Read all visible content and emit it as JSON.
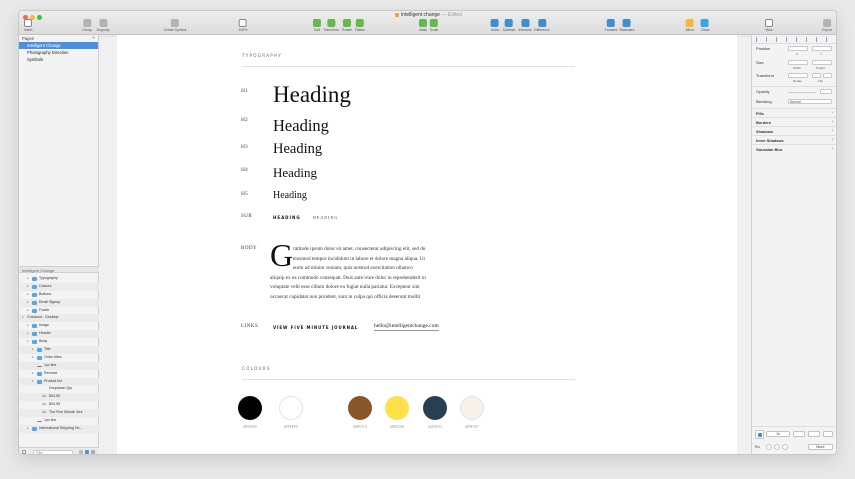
{
  "window": {
    "document_title": "intelligent change",
    "document_status": "— Edited"
  },
  "toolbar": {
    "items": [
      {
        "label": "Insert",
        "icon": "plus-icon"
      },
      {
        "label": "Group",
        "icon": "group-icon"
      },
      {
        "label": "Ungroup",
        "icon": "ungroup-icon"
      },
      {
        "label": "Create Symbol",
        "icon": "create-symbol-icon"
      },
      {
        "label": "100%",
        "icon": "zoom-icon"
      },
      {
        "label": "Edit",
        "icon": "edit-icon"
      },
      {
        "label": "Transform",
        "icon": "transform-icon"
      },
      {
        "label": "Rotate",
        "icon": "rotate-icon"
      },
      {
        "label": "Flatten",
        "icon": "flatten-icon"
      },
      {
        "label": "Mask",
        "icon": "mask-icon"
      },
      {
        "label": "Scale",
        "icon": "scale-icon"
      },
      {
        "label": "Union",
        "icon": "union-icon"
      },
      {
        "label": "Subtract",
        "icon": "subtract-icon"
      },
      {
        "label": "Intersect",
        "icon": "intersect-icon"
      },
      {
        "label": "Difference",
        "icon": "difference-icon"
      },
      {
        "label": "Forward",
        "icon": "forward-icon"
      },
      {
        "label": "Backward",
        "icon": "backward-icon"
      },
      {
        "label": "Mirror",
        "icon": "mirror-icon"
      },
      {
        "label": "Cloud",
        "icon": "cloud-icon"
      },
      {
        "label": "View",
        "icon": "view-icon"
      },
      {
        "label": "Export",
        "icon": "export-icon"
      }
    ]
  },
  "pages": {
    "header": "Pages",
    "items": [
      "Intelligent Change",
      "Photography Direction",
      "Symbols"
    ],
    "selected_index": 0
  },
  "layers_header": "Intelligent Change",
  "layers": [
    {
      "name": "Typography",
      "type": "folder",
      "depth": 1,
      "expanded": false
    },
    {
      "name": "Colours",
      "type": "folder",
      "depth": 1,
      "expanded": false
    },
    {
      "name": "Buttons",
      "type": "folder",
      "depth": 1,
      "expanded": false
    },
    {
      "name": "Email Signup",
      "type": "folder",
      "depth": 1,
      "expanded": false
    },
    {
      "name": "Footer",
      "type": "folder",
      "depth": 1,
      "expanded": false
    },
    {
      "name": "Checkout - Desktop",
      "type": "artboard",
      "depth": 0,
      "expanded": true
    },
    {
      "name": "Image",
      "type": "folder",
      "depth": 1,
      "expanded": false
    },
    {
      "name": "Header",
      "type": "folder",
      "depth": 1,
      "expanded": false
    },
    {
      "name": "Body",
      "type": "folder",
      "depth": 1,
      "expanded": true
    },
    {
      "name": "Title",
      "type": "folder",
      "depth": 2,
      "expanded": false
    },
    {
      "name": "Order titles",
      "type": "folder",
      "depth": 2,
      "expanded": false
    },
    {
      "name": "1px line",
      "type": "line",
      "depth": 2,
      "expanded": false
    },
    {
      "name": "Remove",
      "type": "folder",
      "depth": 2,
      "expanded": false
    },
    {
      "name": "Product list",
      "type": "folder",
      "depth": 2,
      "expanded": true
    },
    {
      "name": "Dropdown Qty",
      "type": "symbol",
      "depth": 3,
      "expanded": false
    },
    {
      "name": "$34.95",
      "type": "text",
      "depth": 3,
      "expanded": false
    },
    {
      "name": "$34.95",
      "type": "text",
      "depth": 3,
      "expanded": false
    },
    {
      "name": "The Five Minute Jour",
      "type": "text",
      "depth": 3,
      "expanded": false
    },
    {
      "name": "1px line",
      "type": "line",
      "depth": 2,
      "expanded": false
    },
    {
      "name": "International Shipping Ter...",
      "type": "folder",
      "depth": 1,
      "expanded": false
    }
  ],
  "filter": {
    "placeholder": "Filter"
  },
  "artboard": {
    "typography_section": "TYPOGRAPHY",
    "headings": [
      {
        "label": "H1",
        "text": "Heading"
      },
      {
        "label": "H2",
        "text": "Heading"
      },
      {
        "label": "H3",
        "text": "Heading"
      },
      {
        "label": "H4",
        "text": "Heading"
      },
      {
        "label": "H5",
        "text": "Heading"
      }
    ],
    "sub": {
      "label": "SUB",
      "heavy": "HEADING",
      "light": "HEADING"
    },
    "body": {
      "label": "BODY",
      "dropcap": "G",
      "lines": [
        "ratitude ipsum dolor sit amet, consectetur adipiscing elit, sed do",
        "eiusmod tempor incididunt ut labore et dolore magna aliqua. Ut",
        "enim ad minim veniam, quis nostrud exercitation ullamco",
        "aliquip ex ea commodo consequat. Duis aute irure dolor in reprehenderit in",
        "voluptate velit esse cillum dolore eu fugiat nulla pariatur. Excepteur sint",
        "occaecat cupidatat non proident, sunt in culpa qui officia deserunt mollit"
      ]
    },
    "links": {
      "label": "LINKS",
      "heavy": "VIEW FIVE MINUTE JOURNAL",
      "email": "hello@intelligentchange.com"
    },
    "colours_section": "COLOURS",
    "colours": [
      {
        "hex": "#000000",
        "fill": "#000000"
      },
      {
        "hex": "#FFFFFF",
        "fill": "#FFFFFF"
      },
      {
        "hex": "#88572A",
        "fill": "#88572A"
      },
      {
        "hex": "#FEE048",
        "fill": "#FEE048"
      },
      {
        "hex": "#283F53",
        "fill": "#283F53"
      },
      {
        "hex": "#F8F1E7",
        "fill": "#F8F1E7"
      }
    ]
  },
  "inspector": {
    "position_label": "Position",
    "size_label": "Size",
    "width_label": "Width",
    "height_label": "Height",
    "transform_label": "Transform",
    "rotate_label": "Rotate",
    "flip_label": "Flip",
    "opacity_label": "Opacity",
    "blending_label": "Blending",
    "blending_value": "Normal",
    "x_label": "X",
    "y_label": "Y",
    "sections": [
      "Fills",
      "Borders",
      "Shadows",
      "Inner Shadows",
      "Gaussian Blur"
    ],
    "make_exportable": "1x",
    "export_size": "1x",
    "export_format": "More",
    "export_label": "Ro"
  }
}
